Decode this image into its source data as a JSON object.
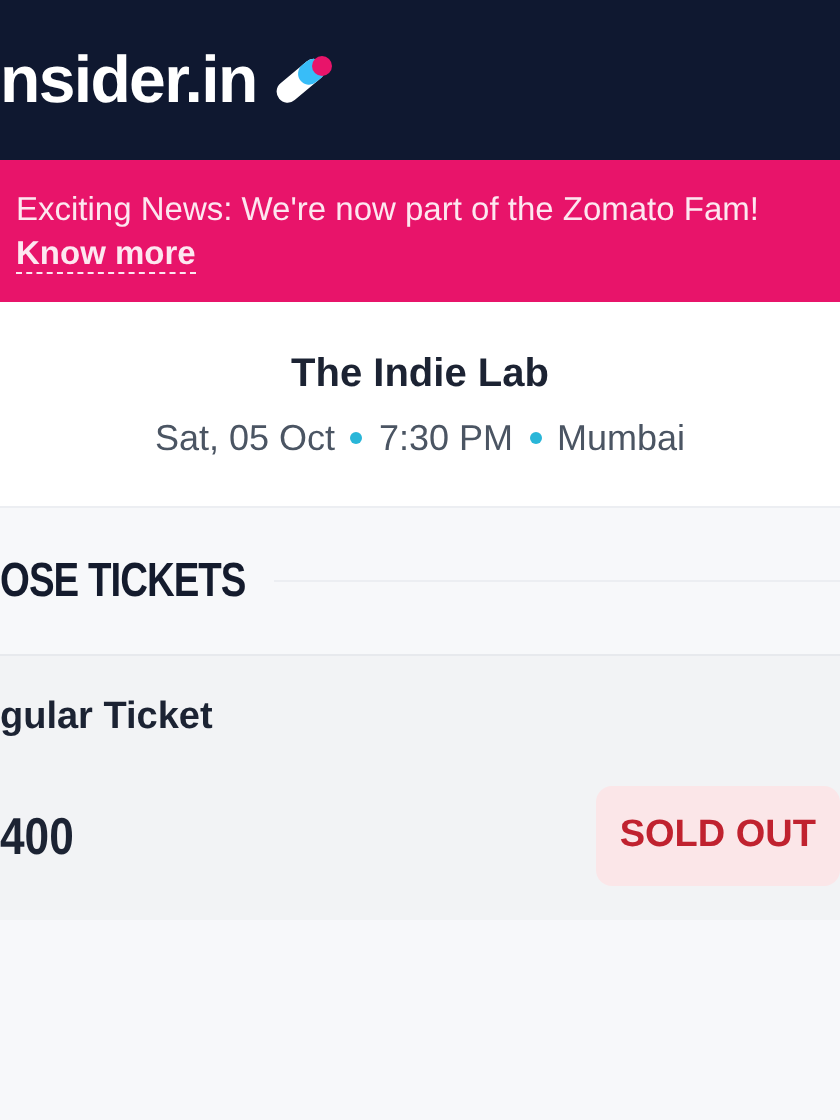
{
  "header": {
    "logo_text": "nsider.in"
  },
  "banner": {
    "text": "Exciting News: We're now part of the Zomato Fam!",
    "link": "Know more"
  },
  "event": {
    "title": "The Indie Lab",
    "meta": [
      "Sat, 05 Oct",
      "7:30 PM",
      "Mumbai"
    ]
  },
  "section": {
    "title": "OSE TICKETS"
  },
  "tickets": [
    {
      "name": "gular Ticket",
      "price": "400",
      "sold_out": true,
      "status": "SOLD OUT"
    }
  ]
}
